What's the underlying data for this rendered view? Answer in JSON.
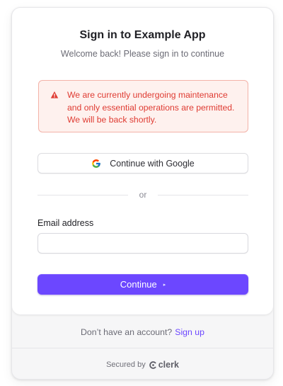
{
  "card": {
    "title": "Sign in to Example App",
    "subtitle": "Welcome back! Please sign in to continue"
  },
  "alert": {
    "icon": "warning-triangle-icon",
    "message": "We are currently undergoing maintenance and only essential operations are permitted. We will be back shortly.",
    "color": "#df3b32"
  },
  "social": {
    "google_label": "Continue with Google",
    "icon": "google-icon"
  },
  "divider": {
    "text": "or"
  },
  "form": {
    "email_label": "Email address",
    "email_value": "",
    "email_placeholder": ""
  },
  "continue_button": {
    "label": "Continue",
    "arrow": "▸",
    "color": "#6c47ff"
  },
  "footer": {
    "signup_prompt": "Don’t have an account?",
    "signup_link": "Sign up",
    "secured_by": "Secured by",
    "brand": "clerk",
    "brand_icon": "clerk-logo-icon"
  }
}
